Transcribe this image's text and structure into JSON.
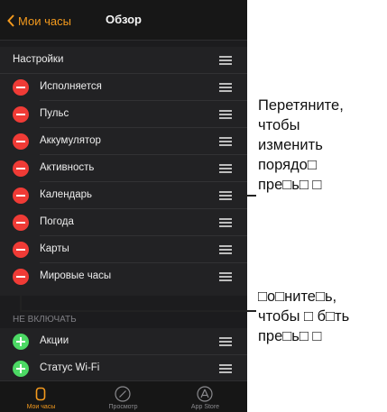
{
  "navbar": {
    "back_label": "Мои часы",
    "title": "Обзор"
  },
  "header_row": {
    "label": "Настройки"
  },
  "included": [
    {
      "label": "Исполняется"
    },
    {
      "label": "Пульс"
    },
    {
      "label": "Аккумулятор"
    },
    {
      "label": "Активность"
    },
    {
      "label": "Календарь"
    },
    {
      "label": "Погода"
    },
    {
      "label": "Карты"
    },
    {
      "label": "Мировые часы"
    }
  ],
  "excluded_section_label": "НЕ ВКЛЮЧАТЬ",
  "excluded": [
    {
      "label": "Акции"
    },
    {
      "label": "Статус Wi-Fi"
    }
  ],
  "tabbar": {
    "tabs": [
      {
        "label": "Мои часы",
        "icon": "watch-icon",
        "active": true
      },
      {
        "label": "Просмотр",
        "icon": "compass-icon",
        "active": false
      },
      {
        "label": "App Store",
        "icon": "app-store-icon",
        "active": false
      }
    ]
  },
  "callouts": {
    "drag": {
      "lines": [
        "Перетяните,",
        "чтобы",
        "изменить",
        "порядо□",
        "пре□ь□ □"
      ]
    },
    "remove": {
      "lines": [
        "□о□ните□ь,",
        "чтобы □ б□ть",
        "пре□ь□ □"
      ]
    }
  },
  "colors": {
    "accent": "#f49a1d",
    "minus": "#f03b36",
    "plus": "#4cd964"
  }
}
